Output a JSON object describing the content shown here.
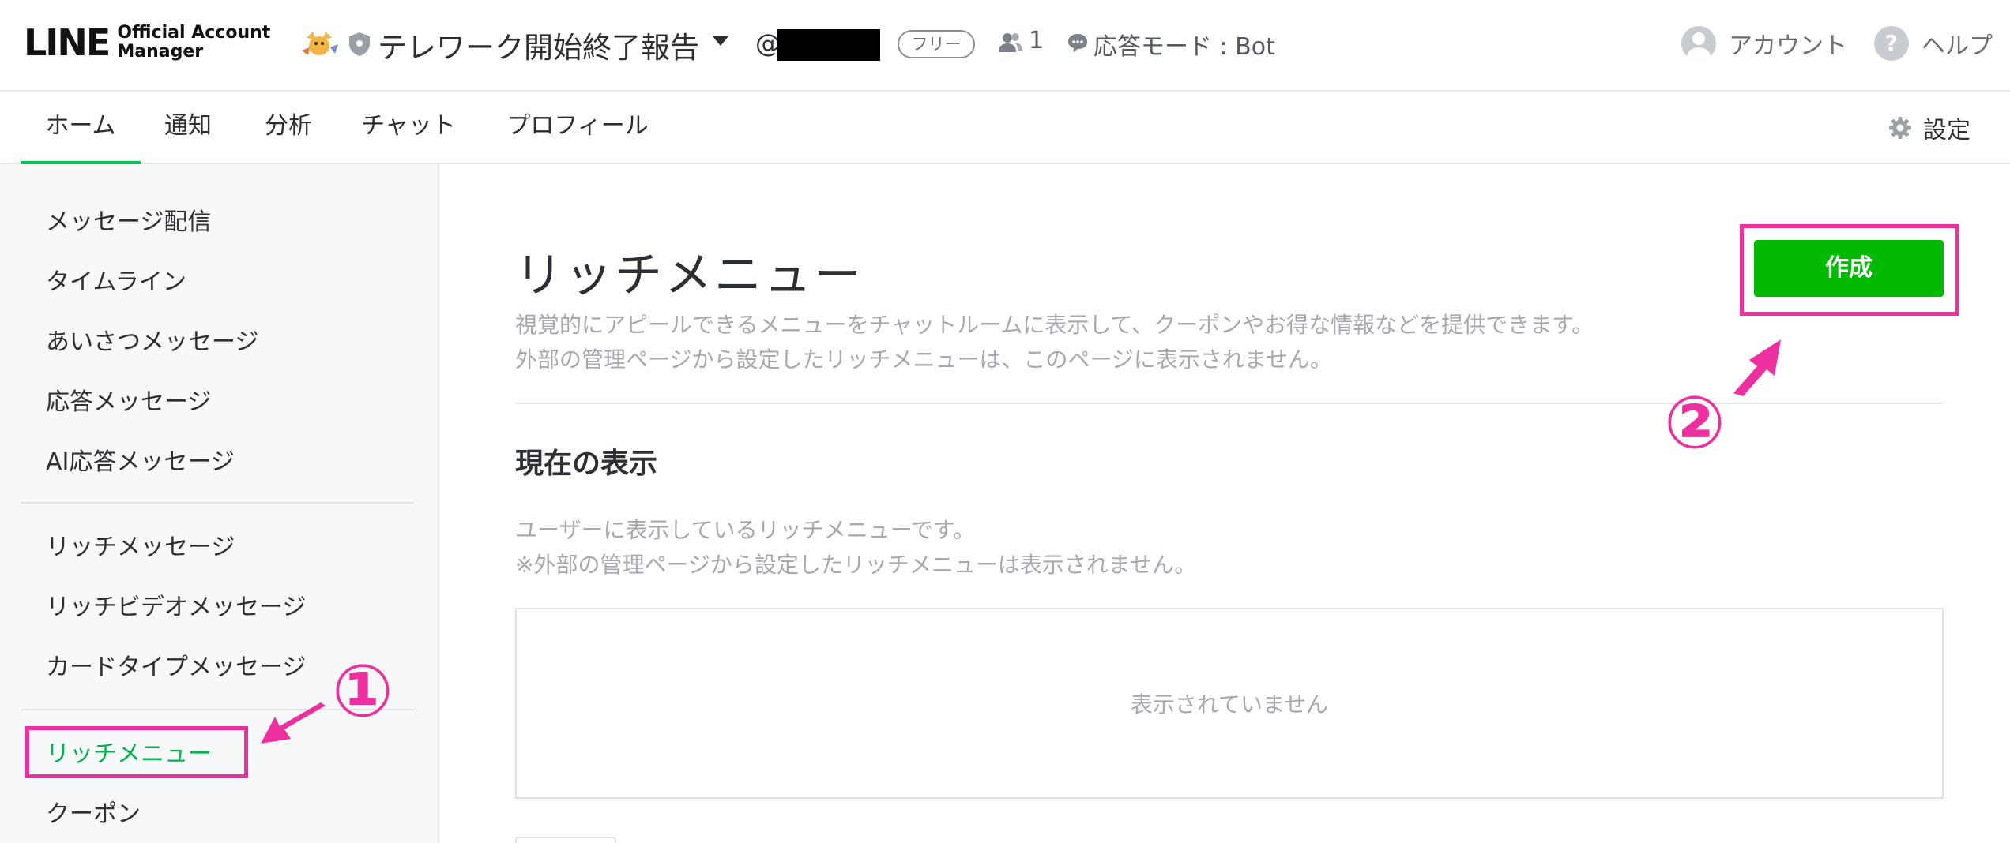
{
  "header": {
    "logo_main": "LINE",
    "logo_sub_line1": "Official Account",
    "logo_sub_line2": "Manager",
    "account_name": "テレワーク開始終了報告",
    "account_id_prefix": "@",
    "plan_badge": "フリー",
    "friends_count": "1",
    "chat_mode": "応答モード : Bot",
    "account_label": "アカウント",
    "help_icon_glyph": "?",
    "help_label": "ヘルプ"
  },
  "tabs": [
    {
      "label": "ホーム",
      "active": true
    },
    {
      "label": "通知"
    },
    {
      "label": "分析"
    },
    {
      "label": "チャット"
    },
    {
      "label": "プロフィール"
    }
  ],
  "settings_label": "設定",
  "sidebar": {
    "items": [
      {
        "label": "メッセージ配信"
      },
      {
        "label": "タイムライン"
      },
      {
        "label": "あいさつメッセージ"
      },
      {
        "label": "応答メッセージ"
      },
      {
        "label": "AI応答メッセージ"
      },
      {
        "label": "リッチメッセージ"
      },
      {
        "label": "リッチビデオメッセージ"
      },
      {
        "label": "カードタイプメッセージ"
      },
      {
        "label": "リッチメニュー",
        "active": true
      },
      {
        "label": "クーポン"
      }
    ]
  },
  "main": {
    "title": "リッチメニュー",
    "description_line1": "視覚的にアピールできるメニューをチャットルームに表示して、クーポンやお得な情報などを提供できます。",
    "description_line2": "外部の管理ページから設定したリッチメニューは、このページに表示されません。",
    "section_title": "現在の表示",
    "section_desc_line1": "ユーザーに表示しているリッチメニューです。",
    "section_desc_line2": "※外部の管理ページから設定したリッチメニューは表示されません。",
    "empty_message": "表示されていません",
    "create_button": "作成"
  },
  "annotations": {
    "callout_1": "①",
    "callout_2": "②",
    "color": "#ee2fa0"
  },
  "colors": {
    "brand_green": "#06c755",
    "button_green": "#00b900",
    "active_sidebar_text": "#06b24d",
    "highlight_pink": "#ee2fa0"
  },
  "icons": [
    "account-mascot-icon",
    "shield-icon",
    "caret-down-icon",
    "friends-icon",
    "chat-bubble-icon",
    "avatar-icon",
    "help-icon",
    "gear-icon",
    "arrow-icon"
  ]
}
